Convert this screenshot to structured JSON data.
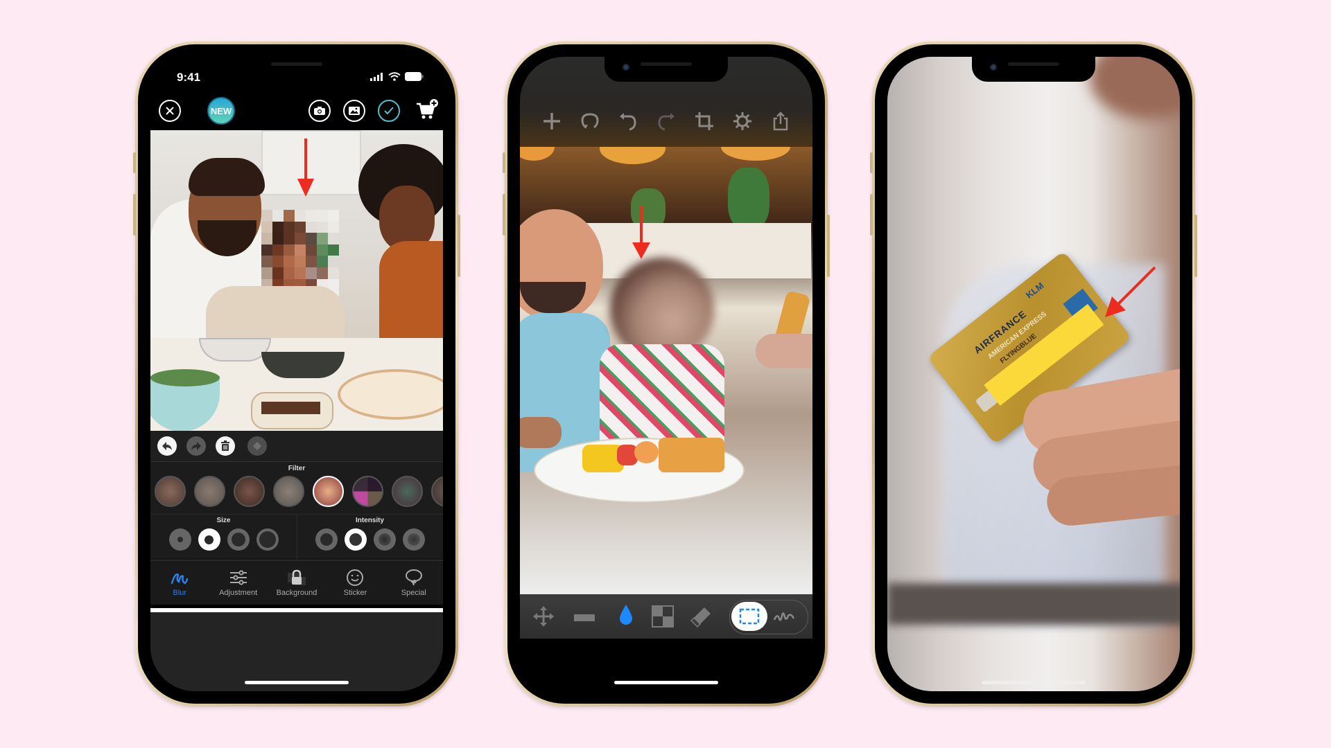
{
  "background_color": "#fdeaf3",
  "phones": [
    {
      "id": "blur-app",
      "status_bar": {
        "time": "9:41"
      },
      "top_bar": {
        "close_icon": "close-icon",
        "new_badge": "NEW",
        "camera_icon": "camera-icon",
        "gallery_icon": "gallery-icon",
        "done_icon": "checkmark-icon",
        "cart_icon": "cart-add-icon"
      },
      "photo": {
        "description": "Family cooking in kitchen; child's face pixelated",
        "annotation": "red-arrow-down"
      },
      "edit_toolbar": [
        "undo-icon",
        "redo-icon",
        "trash-icon",
        "eraser-icon"
      ],
      "filter": {
        "label": "Filter",
        "selected_index": 4,
        "count": 8
      },
      "size": {
        "label": "Size",
        "options": 4,
        "selected_index": 1
      },
      "intensity": {
        "label": "Intensity",
        "options": 4,
        "selected_index": 1
      },
      "tabs": [
        {
          "label": "Blur",
          "icon": "squiggle-brush-icon",
          "active": true
        },
        {
          "label": "Adjustment",
          "icon": "sliders-icon",
          "active": false
        },
        {
          "label": "Background",
          "icon": "lock-icon",
          "active": false
        },
        {
          "label": "Sticker",
          "icon": "smiley-icon",
          "active": false
        },
        {
          "label": "Special",
          "icon": "lasso-icon",
          "active": false
        }
      ],
      "accent_color": "#2f7fe6"
    },
    {
      "id": "photo-editor",
      "top_toolbar": [
        "add-icon",
        "rotate-icon",
        "undo-icon",
        "redo-icon",
        "crop-icon",
        "settings-icon",
        "share-icon"
      ],
      "photo": {
        "description": "Man holding toddler at breakfast table; toddler's face blurred",
        "annotation": "red-arrow-down"
      },
      "bottom_tools": [
        {
          "icon": "move-icon",
          "active": false
        },
        {
          "icon": "bar-icon",
          "active": false
        },
        {
          "icon": "blur-drop-icon",
          "active": true
        },
        {
          "icon": "pixelate-icon",
          "active": false
        },
        {
          "icon": "eraser-icon",
          "active": false
        }
      ],
      "selection_mode": {
        "options": [
          "rectangle-select-icon",
          "freehand-select-icon"
        ],
        "selected_index": 0
      },
      "accent_color": "#1e88ff"
    },
    {
      "id": "card-redaction",
      "photo": {
        "description": "Hand holding credit card; card number covered by yellow box",
        "card_text": [
          "AIRFRANCE",
          "KLM",
          "AMERICAN EXPRESS",
          "FLYINGBLUE"
        ],
        "redaction_color": "#fcd93a",
        "annotation": "red-arrow-diagonal"
      }
    }
  ],
  "annotation_color": "#ee2b1f"
}
